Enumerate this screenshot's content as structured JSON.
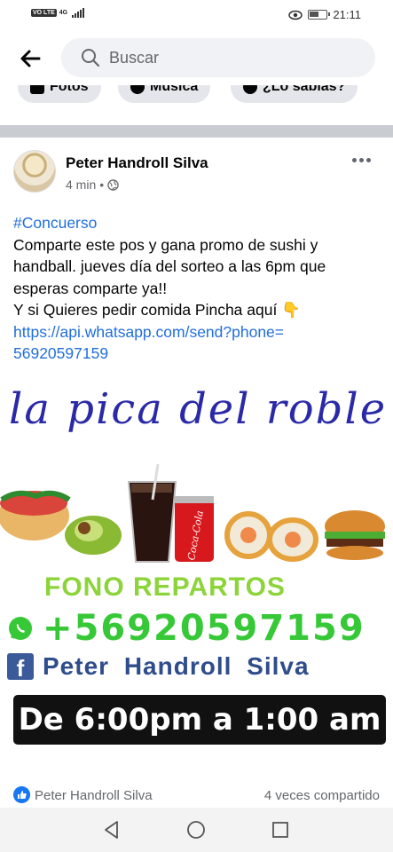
{
  "status_bar": {
    "network": "VO LTE",
    "signal_label": "4G",
    "time": "21:11"
  },
  "search": {
    "placeholder": "Buscar"
  },
  "chips": [
    {
      "label": "Fotos",
      "icon": "photo-icon"
    },
    {
      "label": "Música",
      "icon": "music-icon"
    },
    {
      "label": "¿Lo sabías?",
      "icon": "lightbulb-icon"
    }
  ],
  "post": {
    "author": "Peter Handroll Silva",
    "time_ago": "4 min",
    "privacy_icon": "globe-icon",
    "text": {
      "hashtag": "#Concuerso",
      "line1": "Comparte este pos y gana promo de sushi y",
      "line2": "handball. jueves día del sorteo a las 6pm que",
      "line3": "esperas comparte ya!!",
      "line4": "Y si Quieres pedir comida  Pincha aquí 👇",
      "link_line1": "https://api.whatsapp.com/send?phone=",
      "link_line2": "56920597159"
    },
    "image": {
      "title": "la pica del roble",
      "fono_label": "FONO REPARTOS",
      "phone": "+56920597159",
      "fb_name": "Peter  Handroll  Silva",
      "fb_letter": "f",
      "hours": "De 6:00pm a 1:00 am",
      "can_brand": "Coca-Cola"
    },
    "footer": {
      "reactor": "Peter Handroll Silva",
      "shares": "4 veces compartido"
    }
  },
  "colors": {
    "link": "#216fdb",
    "brand_blue": "#1877f2",
    "whatsapp_green": "#37c837",
    "title_blue": "#2a2aa8"
  }
}
